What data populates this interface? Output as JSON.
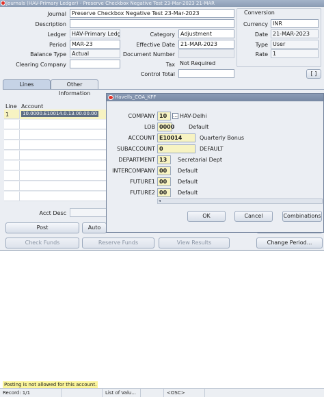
{
  "window": {
    "title": "Journals (HAV-Primary Ledger) - Preserve Checkbox Negative Test 23-Mar-2023 21-MAR"
  },
  "header": {
    "journal_label": "Journal",
    "journal_value": "Preserve Checkbox Negative Test 23-Mar-2023",
    "description_label": "Description",
    "description_value": "",
    "ledger_label": "Ledger",
    "ledger_value": "HAV-Primary Ledge",
    "period_label": "Period",
    "period_value": "MAR-23",
    "balance_type_label": "Balance Type",
    "balance_type_value": "Actual",
    "clearing_company_label": "Clearing Company",
    "clearing_company_value": "",
    "category_label": "Category",
    "category_value": "Adjustment",
    "effective_date_label": "Effective Date",
    "effective_date_value": "21-MAR-2023",
    "document_number_label": "Document Number",
    "document_number_value": "",
    "tax_label": "Tax",
    "tax_value": "Not Required",
    "control_total_label": "Control Total",
    "control_total_value": "",
    "bracket_button": "[ ]"
  },
  "conversion": {
    "title": "Conversion",
    "currency_label": "Currency",
    "currency_value": "INR",
    "date_label": "Date",
    "date_value": "21-MAR-2023",
    "type_label": "Type",
    "type_value": "User",
    "rate_label": "Rate",
    "rate_value": "1"
  },
  "tabs": [
    {
      "label": "Lines"
    },
    {
      "label": "Other Information"
    }
  ],
  "lines": {
    "col_line": "Line",
    "col_account": "Account",
    "rows": [
      {
        "line": "1",
        "account": "10.0000.E10014.0.13.00.00.00"
      }
    ],
    "acct_desc_label": "Acct Desc"
  },
  "buttons": {
    "post": "Post",
    "auto": "Auto",
    "check_funds": "Check Funds",
    "reserve_funds": "Reserve Funds",
    "view_results": "View Results",
    "change_period": "Change Period..."
  },
  "kff_dialog": {
    "title": "Havells_COA_KFF",
    "segments": [
      {
        "label": "COMPANY",
        "value": "10",
        "desc": "HAV-Delhi"
      },
      {
        "label": "LOB",
        "value": "0000",
        "desc": "Default"
      },
      {
        "label": "ACCOUNT",
        "value": "E10014",
        "desc": "Quarterly Bonus"
      },
      {
        "label": "SUBACCOUNT",
        "value": "0",
        "desc": "DEFAULT"
      },
      {
        "label": "DEPARTMENT",
        "value": "13",
        "desc": "Secretarial Dept"
      },
      {
        "label": "INTERCOMPANY",
        "value": "00",
        "desc": "Default"
      },
      {
        "label": "FUTURE1",
        "value": "00",
        "desc": "Default"
      },
      {
        "label": "FUTURE2",
        "value": "00",
        "desc": "Default"
      }
    ],
    "ok": "OK",
    "cancel": "Cancel",
    "combinations": "Combinations"
  },
  "status": {
    "message": "Posting is not allowed for this account.",
    "record": "Record: 1/1",
    "list_of_values": "List of Valu...",
    "osc": "<OSC>"
  },
  "colors": {
    "selected_row": "#f7f3c2",
    "message_bg": "#fbf59b",
    "title_bar": "#8b9cb4"
  }
}
